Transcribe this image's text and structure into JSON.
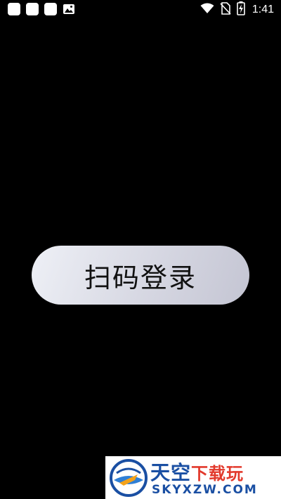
{
  "status_bar": {
    "time": "1:41",
    "notification_icons": [
      "app-notification-icon",
      "app-notification-icon",
      "app-notification-icon",
      "image-icon"
    ],
    "system_icons": [
      "wifi-icon",
      "no-sim-icon",
      "battery-charging-icon"
    ]
  },
  "main": {
    "login_button_label": "扫码登录"
  },
  "watermark": {
    "title_main": "天空",
    "title_accent": "下载玩",
    "domain": "SKYXZW.COM"
  },
  "colors": {
    "background": "#000000",
    "button_light": "#eef0f6",
    "button_dark": "#c4c5d3",
    "watermark_blue": "#1a4fa3",
    "watermark_red": "#e2392c"
  }
}
